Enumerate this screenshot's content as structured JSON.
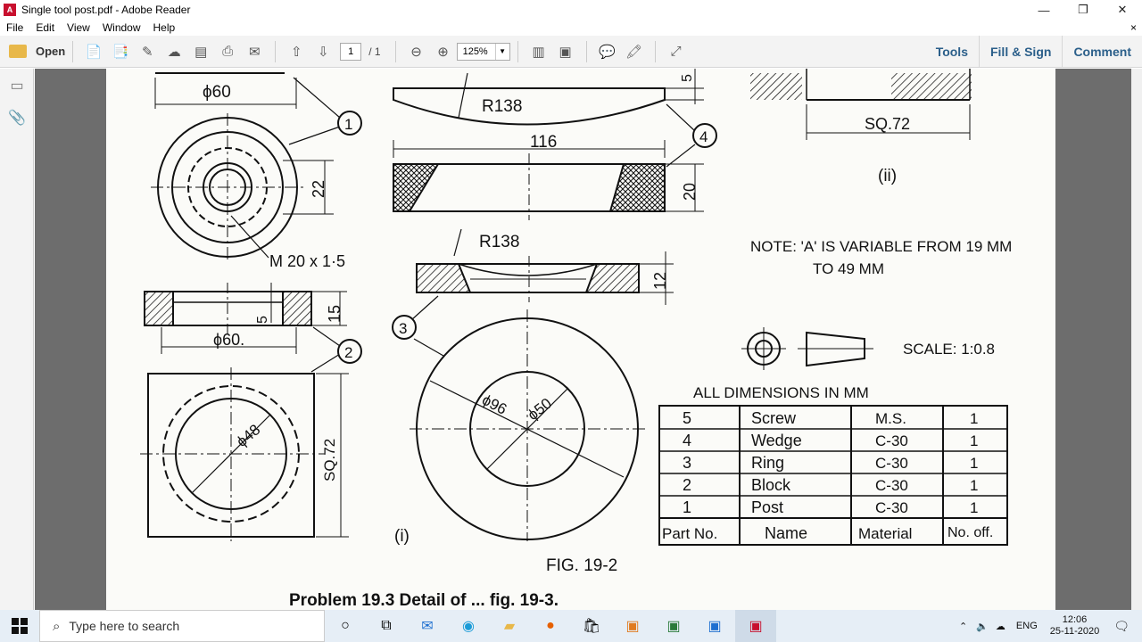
{
  "window": {
    "title": "Single tool post.pdf - Adobe Reader",
    "minimize": "—",
    "restore": "❐",
    "close": "✕"
  },
  "menu": {
    "items": [
      "File",
      "Edit",
      "View",
      "Window",
      "Help"
    ],
    "close": "×"
  },
  "toolbar": {
    "open_label": "Open",
    "page_current": "1",
    "page_total": "/ 1",
    "zoom": "125%",
    "tools": "Tools",
    "fill_sign": "Fill & Sign",
    "comment": "Comment"
  },
  "drawing": {
    "dia60_top": "ϕ60",
    "r138_top": "R138",
    "dim116": "116",
    "dim5_top": "5",
    "dim20": "20",
    "dim22": "22",
    "thread": "M 20 x 1·5",
    "r138_mid": "R138",
    "dim12": "12",
    "dim15": "15",
    "dim5_mid": "5",
    "dia60_mid": "ϕ60.",
    "dia48": "ϕ48",
    "sq72_left": "SQ.72",
    "dia96": "ϕ96",
    "dia50": "ϕ50",
    "sq72_top": "SQ.72",
    "view_ii": "(ii)",
    "view_i": "(i)",
    "note_line1": "NOTE:  'A' IS VARIABLE FROM 19 MM",
    "note_line2": "TO 49 MM",
    "scale": "SCALE: 1:0.8",
    "all_dims": "ALL DIMENSIONS IN MM",
    "fig": "FIG. 19-2",
    "problem": "Problem  19.3  Detail  of  ...  fig. 19-3.",
    "callouts": [
      "1",
      "2",
      "3",
      "4"
    ]
  },
  "parts_table": {
    "headers": [
      "Part No.",
      "Name",
      "Material",
      "No. off."
    ],
    "rows": [
      [
        "5",
        "Screw",
        "M.S.",
        "1"
      ],
      [
        "4",
        "Wedge",
        "C-30",
        "1"
      ],
      [
        "3",
        "Ring",
        "C-30",
        "1"
      ],
      [
        "2",
        "Block",
        "C-30",
        "1"
      ],
      [
        "1",
        "Post",
        "C-30",
        "1"
      ]
    ]
  },
  "taskbar": {
    "search_placeholder": "Type here to search",
    "language": "ENG",
    "time": "12:06",
    "date": "25-11-2020"
  }
}
